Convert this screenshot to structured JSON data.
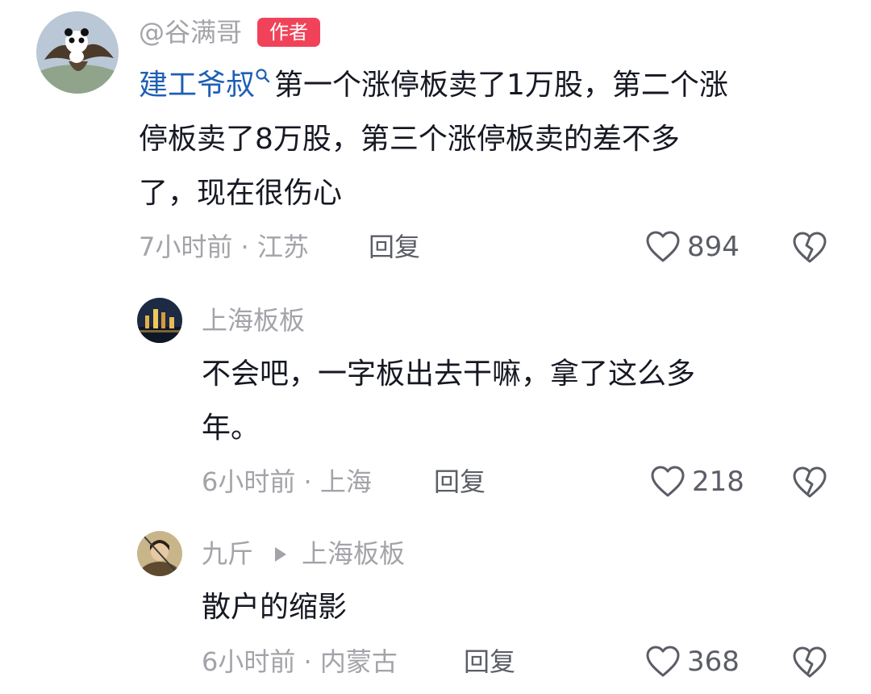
{
  "comments": [
    {
      "username": "@谷满哥",
      "badge": "作者",
      "mention": "建工爷叔",
      "text_line1": "第一个涨停板卖了1万股，第二个涨",
      "text_line2": "停板卖了8万股，第三个涨停板卖的差不多",
      "text_line3": "了，现在很伤心",
      "time_location": "7小时前 · 江苏",
      "reply_label": "回复",
      "like_count": "894",
      "icons": [
        "avatar-panda-eagle",
        "search-icon",
        "heart-icon",
        "broken-heart-icon"
      ]
    },
    {
      "username": "上海板板",
      "text_line1": "不会吧，一字板出去干嘛，拿了这么多",
      "text_line2": "年。",
      "time_location": "6小时前 · 上海",
      "reply_label": "回复",
      "like_count": "218",
      "icons": [
        "avatar-night-city",
        "heart-icon",
        "broken-heart-icon"
      ]
    },
    {
      "username": "九斤",
      "reply_to": "上海板板",
      "text_line1": "散户的缩影",
      "time_location": "6小时前 · 内蒙古",
      "reply_label": "回复",
      "like_count": "368",
      "icons": [
        "avatar-warrior",
        "play-arrow-icon",
        "heart-icon",
        "broken-heart-icon"
      ]
    }
  ],
  "colors": {
    "badge": "#f0435a",
    "mention": "#1f5fb4",
    "muted": "#a3a3a9",
    "text": "#161823"
  }
}
